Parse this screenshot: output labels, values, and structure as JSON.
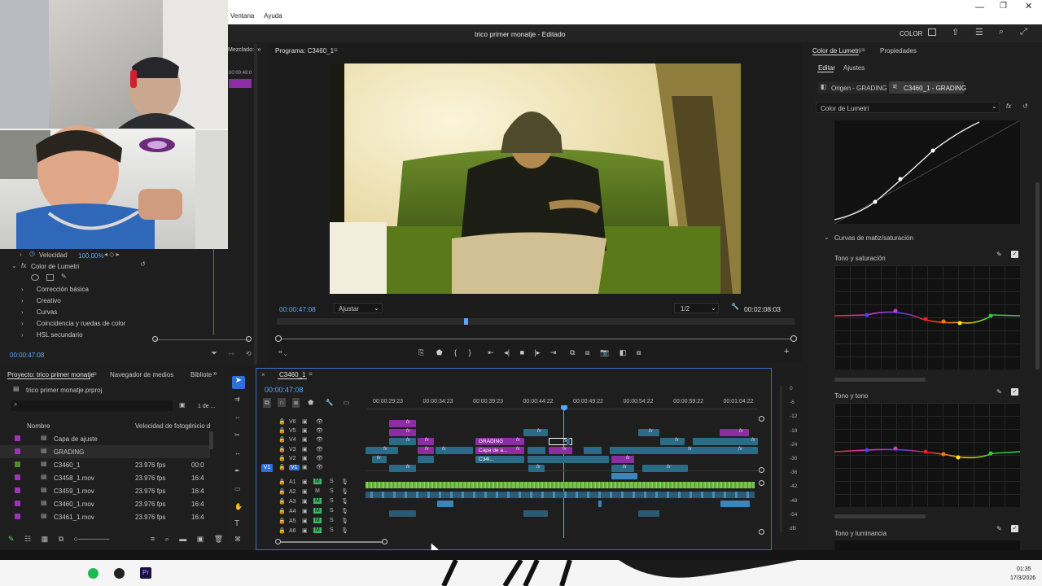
{
  "window": {
    "menu_items": [
      "Ventana",
      "Ayuda"
    ],
    "title": "trico primer monatje - Editado",
    "workspace_label": "COLOR"
  },
  "effects_panel": {
    "header_tab": "Mezclado:",
    "header_time": "00:00:48:0",
    "velocidad_label": "Velocidad",
    "velocidad_value": "100.00%",
    "lumetri_label": "Color de Lumetri",
    "sections": [
      "Corrección básica",
      "Creativo",
      "Curvas",
      "Coincidencia y ruedas de color",
      "HSL secundario"
    ],
    "timecode": "00:00:47:08"
  },
  "program_monitor": {
    "title": "Programa: C3460_1",
    "timecode": "00:00:47:08",
    "fit": "Ajustar",
    "resolution": "1/2",
    "duration": "00:02:08:03"
  },
  "project": {
    "tabs": [
      "Proyecto: trico primer monatje",
      "Navegador de medios",
      "Biblioteca"
    ],
    "file": "trico primer monatje.prproj",
    "count": "1 de ...",
    "columns": [
      "Nombre",
      "Velocidad de fotogr",
      "Inicio d"
    ],
    "items": [
      {
        "name": "Capa de ajuste",
        "fps": "",
        "start": "",
        "color": "#9b35b5"
      },
      {
        "name": "GRADING",
        "fps": "",
        "start": "",
        "color": "#9b35b5"
      },
      {
        "name": "C3460_1",
        "fps": "23.976 fps",
        "start": "00:0",
        "color": "#4c8a2a"
      },
      {
        "name": "C3458_1.mov",
        "fps": "23.976 fps",
        "start": "16:4",
        "color": "#9b35b5"
      },
      {
        "name": "C3459_1.mov",
        "fps": "23.976 fps",
        "start": "16:4",
        "color": "#9b35b5"
      },
      {
        "name": "C3460_1.mov",
        "fps": "23.976 fps",
        "start": "16:4",
        "color": "#9b35b5"
      },
      {
        "name": "C3461_1.mov",
        "fps": "23.976 fps",
        "start": "16:4",
        "color": "#9b35b5"
      }
    ]
  },
  "timeline": {
    "tab": "C3460_1",
    "timecode": "00:00:47:08",
    "ruler": [
      "00:00:29:23",
      "00:00:34:23",
      "00:00:39:23",
      "00:00:44:22",
      "00:00:49:22",
      "00:00:54:22",
      "00:00:59:22",
      "00:01:04:22"
    ],
    "video_tracks": [
      "V6",
      "V5",
      "V4",
      "V3",
      "V2",
      "V1"
    ],
    "audio_tracks": [
      "A1",
      "A2",
      "A3",
      "A4",
      "A5",
      "A6"
    ],
    "clip_labels": {
      "grading": "GRADING",
      "capa": "Capa de a...",
      "c34": "C34l..."
    },
    "meter_scale": [
      "0",
      "-6",
      "-12",
      "-18",
      "-24",
      "-30",
      "-36",
      "-42",
      "-48",
      "-54",
      "dB"
    ]
  },
  "lumetri": {
    "tabs": [
      "Color de Lumetri",
      "Propiedades"
    ],
    "subtabs": [
      "Editar",
      "Ajustes"
    ],
    "source_a": "Origen - GRADING",
    "source_b": "C3460_1 - GRADING",
    "effect_select": "Color de Lumetri",
    "section": "Curvas de matiz/saturación",
    "curve_labels": [
      "Tono y saturación",
      "Tono y tono",
      "Tono y luminancia"
    ]
  },
  "taskbar": {
    "time": "01:35",
    "date": "17/3/2026"
  },
  "colors": {
    "accent_blue": "#3d6dcc",
    "timecode_blue": "#5aa7ff",
    "fx_purple": "#8b2ea3",
    "clip_teal": "#2a6b85",
    "audio_green": "#8fd46a"
  }
}
